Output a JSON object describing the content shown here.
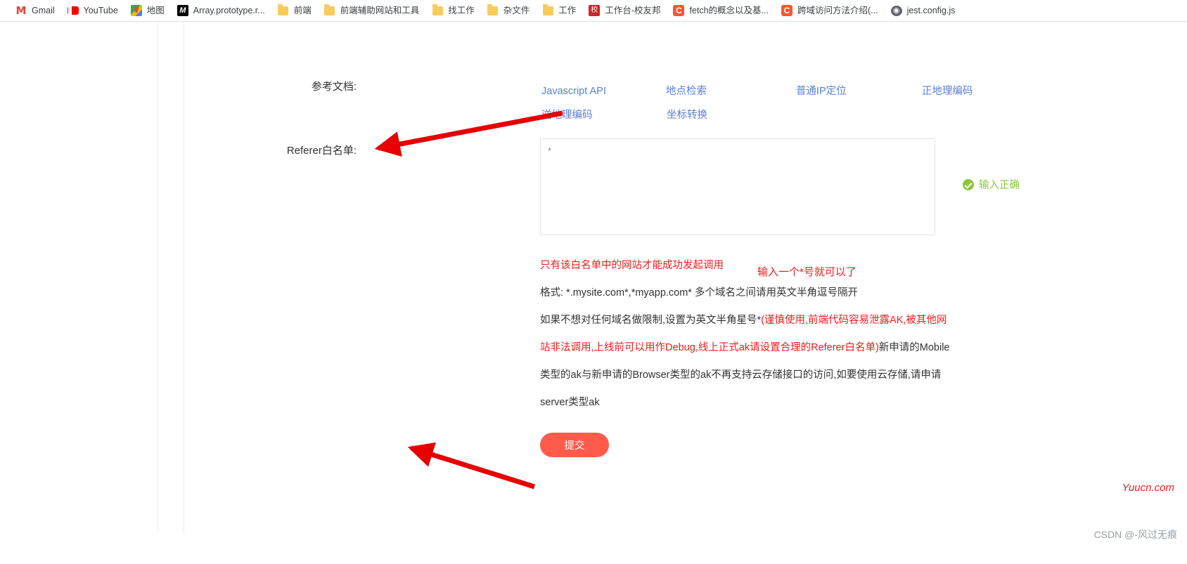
{
  "browser": {
    "bookmarks": [
      {
        "label": "Gmail",
        "icon": "gmail-icon"
      },
      {
        "label": "YouTube",
        "icon": "youtube-icon"
      },
      {
        "label": "地图",
        "icon": "google-maps-icon"
      },
      {
        "label": "Array.prototype.r...",
        "icon": "mdn-icon"
      },
      {
        "label": "前端",
        "icon": "folder-icon"
      },
      {
        "label": "前端辅助网站和工具",
        "icon": "folder-icon"
      },
      {
        "label": "找工作",
        "icon": "folder-icon"
      },
      {
        "label": "杂文件",
        "icon": "folder-icon"
      },
      {
        "label": "工作",
        "icon": "folder-icon"
      },
      {
        "label": "工作台-校友邦",
        "icon": "xiaoyoubang-icon"
      },
      {
        "label": "fetch的概念以及基...",
        "icon": "csdn-icon"
      },
      {
        "label": "跨域访问方法介绍(...",
        "icon": "csdn-icon"
      },
      {
        "label": "jest.config.js",
        "icon": "globe-icon"
      }
    ]
  },
  "form": {
    "docs_label": "参考文档:",
    "doc_links_row1": [
      "Javascript API",
      "地点检索",
      "普通IP定位",
      "正地理编码"
    ],
    "doc_links_row2": [
      "逆地理编码",
      "坐标转换"
    ],
    "referer_label": "Referer白名单:",
    "referer_value": "*",
    "referer_placeholder": "",
    "validation_message": "输入正确",
    "validation_color": "#8dc63f",
    "hints": {
      "line1": "只有该白名单中的网站才能成功发起调用",
      "line2": "格式:  *.mysite.com*,*myapp.com* 多个域名之间请用英文半角逗号隔开",
      "line3_black_a": "如果不想对任何域名做限制,设置为英文半角星号*",
      "line3_red": "(谨慎使用,前端代码容易泄露AK,被其他网站非法调用,上线前可以用作Debug,线上正式ak请设置合理的Referer白名单)",
      "line3_black_b": "新申请的Mobile类型的ak与新申请的Browser类型的ak不再支持云存储接口的访问,如要使用云存储,请申请server类型ak"
    },
    "submit_label": "提交"
  },
  "annotations": {
    "textarea_note": "输入一个*号就可以了",
    "arrow_color": "#e60000"
  },
  "watermarks": {
    "yuucn": "Yuucn.com",
    "csdn": "CSDN @-风过无痕"
  },
  "colors": {
    "accent_red": "#ff5b4a",
    "link_blue": "#5a7fd4",
    "hint_red": "#ee1c1c",
    "success_green": "#8dc63f"
  }
}
